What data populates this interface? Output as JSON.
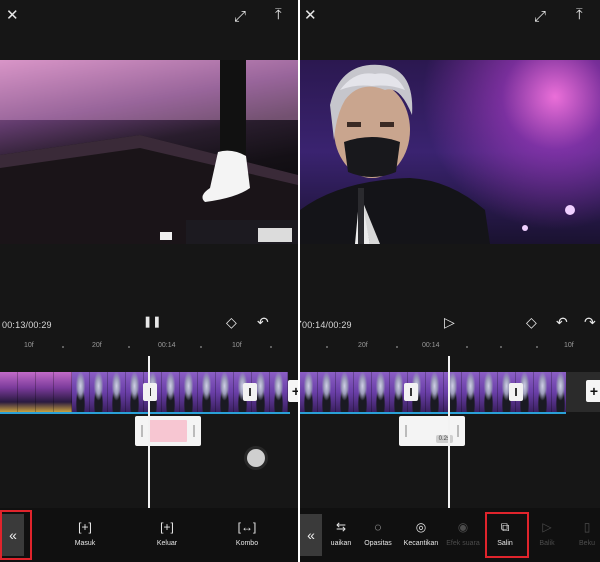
{
  "left": {
    "time": "00:13/00:29",
    "ruler": [
      "10f",
      "20f",
      "00:14",
      "10f"
    ],
    "tools": [
      {
        "icon": "[+]",
        "label": "Masuk"
      },
      {
        "icon": "[+]",
        "label": "Keluar"
      },
      {
        "icon": "[↔]",
        "label": "Kombo"
      }
    ],
    "collapse": "«"
  },
  "right": {
    "time": "00:14/00:29",
    "ruler": [
      "20f",
      "00:14",
      "10f"
    ],
    "speed_badge": "0.2s",
    "tools": [
      {
        "icon": "⇆",
        "label": "uaikan"
      },
      {
        "icon": "◌",
        "label": "Opasitas"
      },
      {
        "icon": "◎",
        "label": "Kecantikan"
      },
      {
        "icon": "◉",
        "label": "Efek suara"
      },
      {
        "icon": "⧉",
        "label": "Salin"
      },
      {
        "icon": "▷",
        "label": "Balik"
      },
      {
        "icon": "▯",
        "label": "Beku"
      }
    ],
    "collapse": "«"
  },
  "icons": {
    "close": "✕",
    "fullscreen": "⤢",
    "export": "⤒",
    "pause": "❚❚",
    "play": "▷",
    "keyframe": "◇",
    "undo": "↶",
    "redo": "↷",
    "plus": "+"
  },
  "colors": {
    "highlight": "#e0242c",
    "accent_line": "#2aa0d6",
    "clip_fill": "#f7c6d2"
  }
}
